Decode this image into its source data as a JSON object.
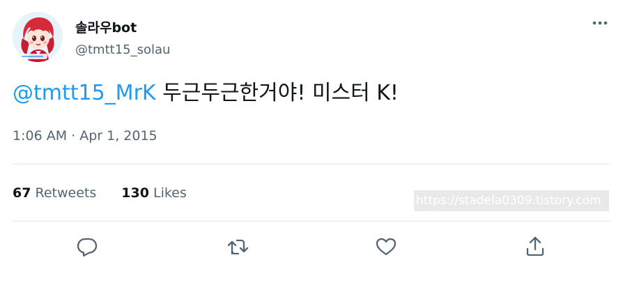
{
  "author": {
    "display_name": "솔라우bot",
    "handle": "@tmtt15_solau",
    "avatar_icon": "anime-character-avatar"
  },
  "tweet": {
    "mention": "@tmtt15_MrK",
    "text": " 두근두근한거야! 미스터 K!",
    "timestamp": "1:06 AM · Apr 1, 2015"
  },
  "stats": {
    "retweets_count": "67",
    "retweets_label": "Retweets",
    "likes_count": "130",
    "likes_label": "Likes"
  },
  "watermark": "https://stadela0309.tistory.com",
  "actions": {
    "reply_icon": "reply-icon",
    "retweet_icon": "retweet-icon",
    "like_icon": "heart-icon",
    "share_icon": "share-icon",
    "more_icon": "more-icon"
  },
  "colors": {
    "link": "#1d9bf0",
    "text": "#0f1419",
    "secondary": "#536471",
    "divider": "#e6e9eb"
  }
}
